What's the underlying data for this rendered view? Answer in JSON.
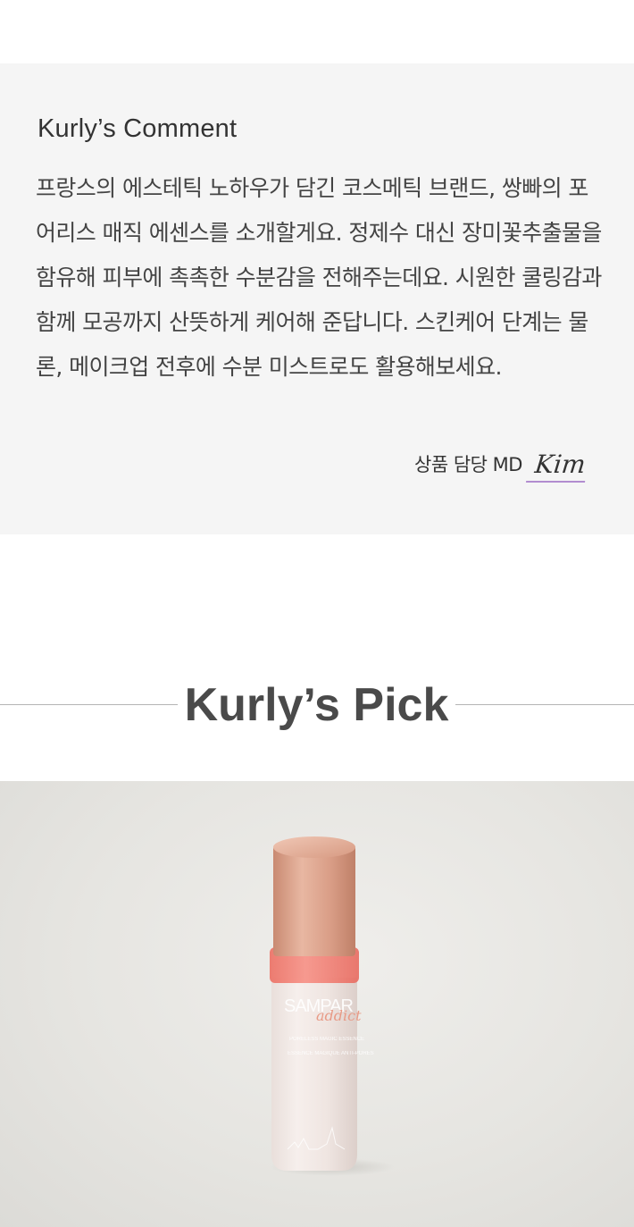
{
  "comment": {
    "title": "Kurly’s Comment",
    "body": "프랑스의 에스테틱 노하우가 담긴 코스메틱 브랜드, 쌍빠의 포어리스 매직 에센스를 소개할게요. 정제수 대신 장미꽃추출물을 함유해 피부에 촉촉한 수분감을 전해주는데요. 시원한 쿨링감과 함께 모공까지 산뜻하게 케어해 준답니다. 스킨케어 단계는 물론, 메이크업 전후에 수분 미스트로도 활용해보세요.",
    "signature_label": "상품 담당 MD",
    "signature_name": "Kim"
  },
  "pick": {
    "title": "Kurly’s Pick"
  },
  "product": {
    "label_brand": "SAMPAR",
    "label_script": "addict",
    "label_line1": "PORELESS MAGIC ESSENCE",
    "label_line2": "ESSENCE MAGIQUE ANTI-PORES"
  },
  "colors": {
    "panel_bg": "#f5f5f5",
    "signature_underline": "#b28dd0",
    "cap": "#d9a28c",
    "collar": "#f27a6e"
  }
}
